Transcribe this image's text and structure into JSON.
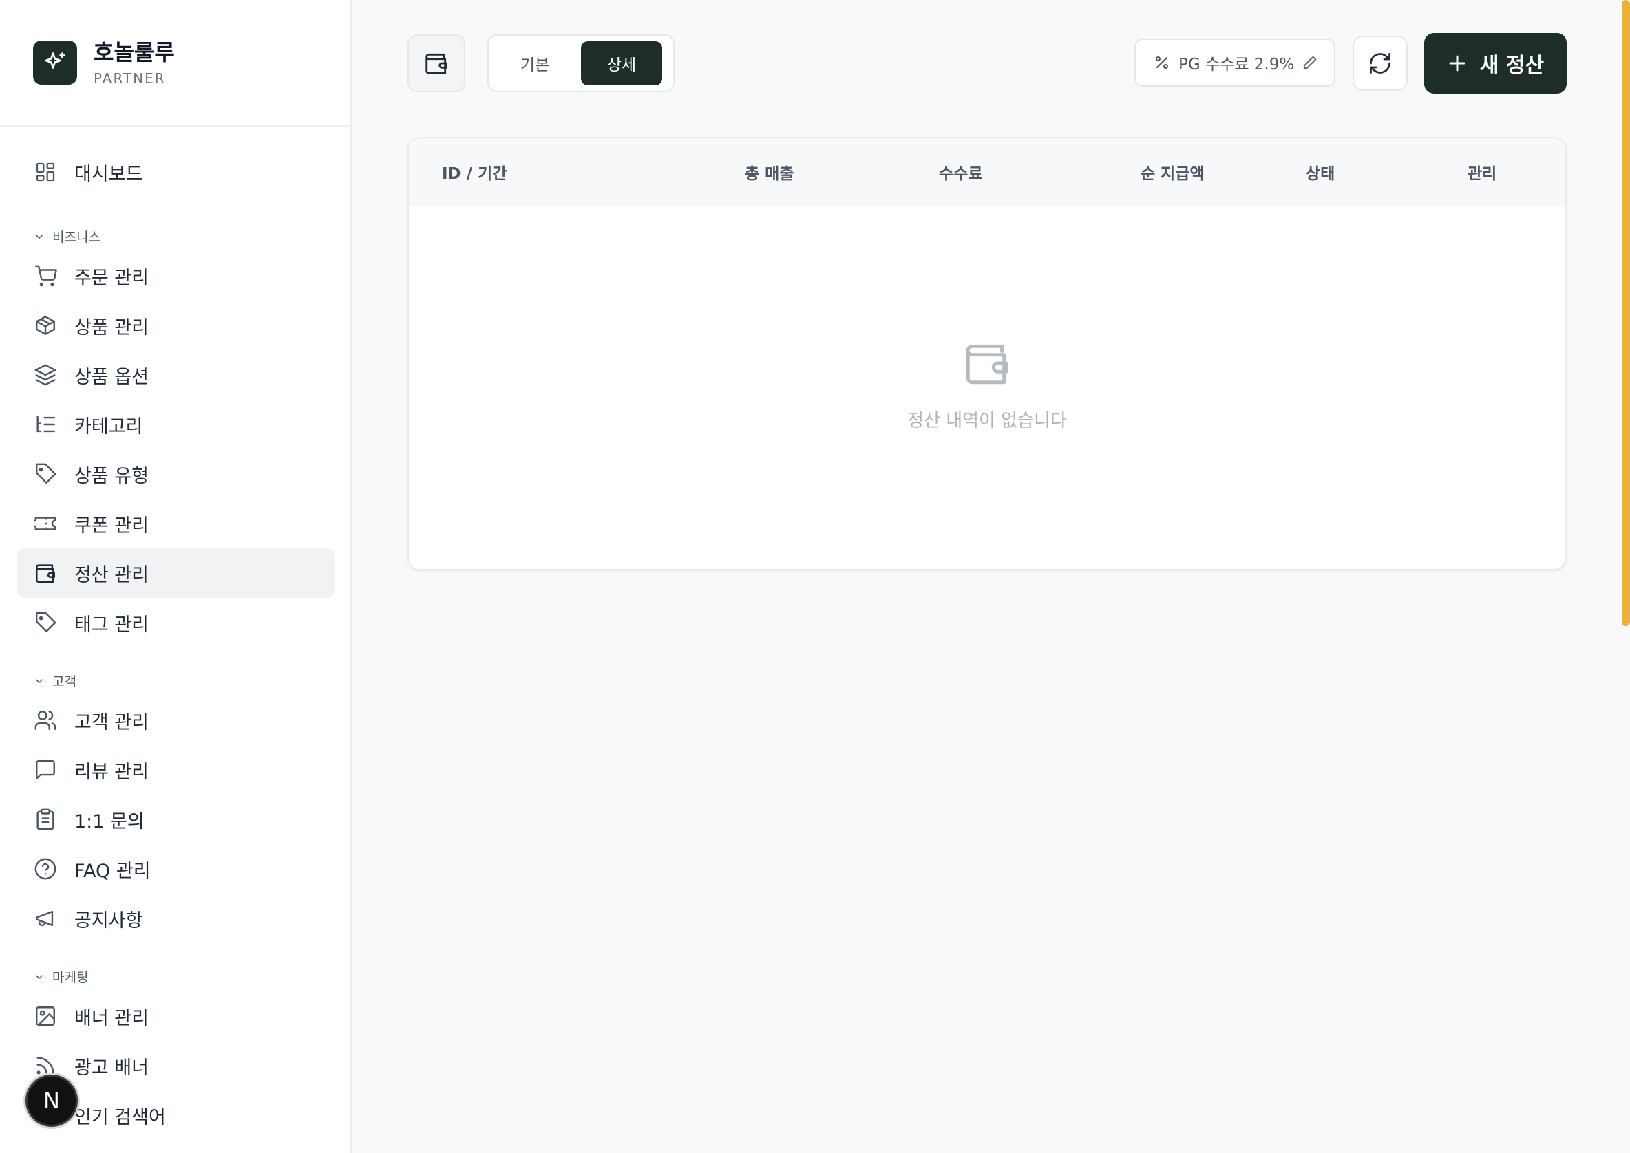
{
  "brand": {
    "title": "호놀룰루",
    "subtitle": "PARTNER"
  },
  "sidebar": {
    "items": [
      {
        "label": "대시보드",
        "icon": "dashboard-icon"
      },
      {
        "label": "비즈니스",
        "group": true
      },
      {
        "label": "주문 관리",
        "icon": "cart-icon"
      },
      {
        "label": "상품 관리",
        "icon": "package-icon"
      },
      {
        "label": "상품 옵션",
        "icon": "layers-icon"
      },
      {
        "label": "카테고리",
        "icon": "list-tree-icon"
      },
      {
        "label": "상품 유형",
        "icon": "tag-icon"
      },
      {
        "label": "쿠폰 관리",
        "icon": "ticket-icon"
      },
      {
        "label": "정산 관리",
        "icon": "wallet-icon",
        "active": true
      },
      {
        "label": "태그 관리",
        "icon": "tag-icon"
      },
      {
        "label": "고객",
        "group": true
      },
      {
        "label": "고객 관리",
        "icon": "users-icon"
      },
      {
        "label": "리뷰 관리",
        "icon": "message-icon"
      },
      {
        "label": "1:1 문의",
        "icon": "clipboard-icon"
      },
      {
        "label": "FAQ 관리",
        "icon": "help-circle-icon"
      },
      {
        "label": "공지사항",
        "icon": "megaphone-icon"
      },
      {
        "label": "마케팅",
        "group": true
      },
      {
        "label": "배너 관리",
        "icon": "image-icon"
      },
      {
        "label": "광고 배너",
        "icon": "rss-icon"
      },
      {
        "label": "인기 검색어",
        "icon": "search-icon"
      }
    ],
    "fab_label": "N"
  },
  "toolbar": {
    "view_toggle": {
      "options": [
        "기본",
        "상세"
      ],
      "selected": "상세"
    },
    "pg_fee_label": "PG 수수료 2.9%",
    "new_button_label": "새 정산"
  },
  "table": {
    "columns": [
      "ID / 기간",
      "총 매출",
      "수수료",
      "순 지급액",
      "상태",
      "관리"
    ],
    "rows": [],
    "empty_text": "정산 내역이 없습니다"
  },
  "colors": {
    "primary": "#1e2d27",
    "scrollbar": "#e9b33b",
    "background": "#f8f9fa"
  }
}
